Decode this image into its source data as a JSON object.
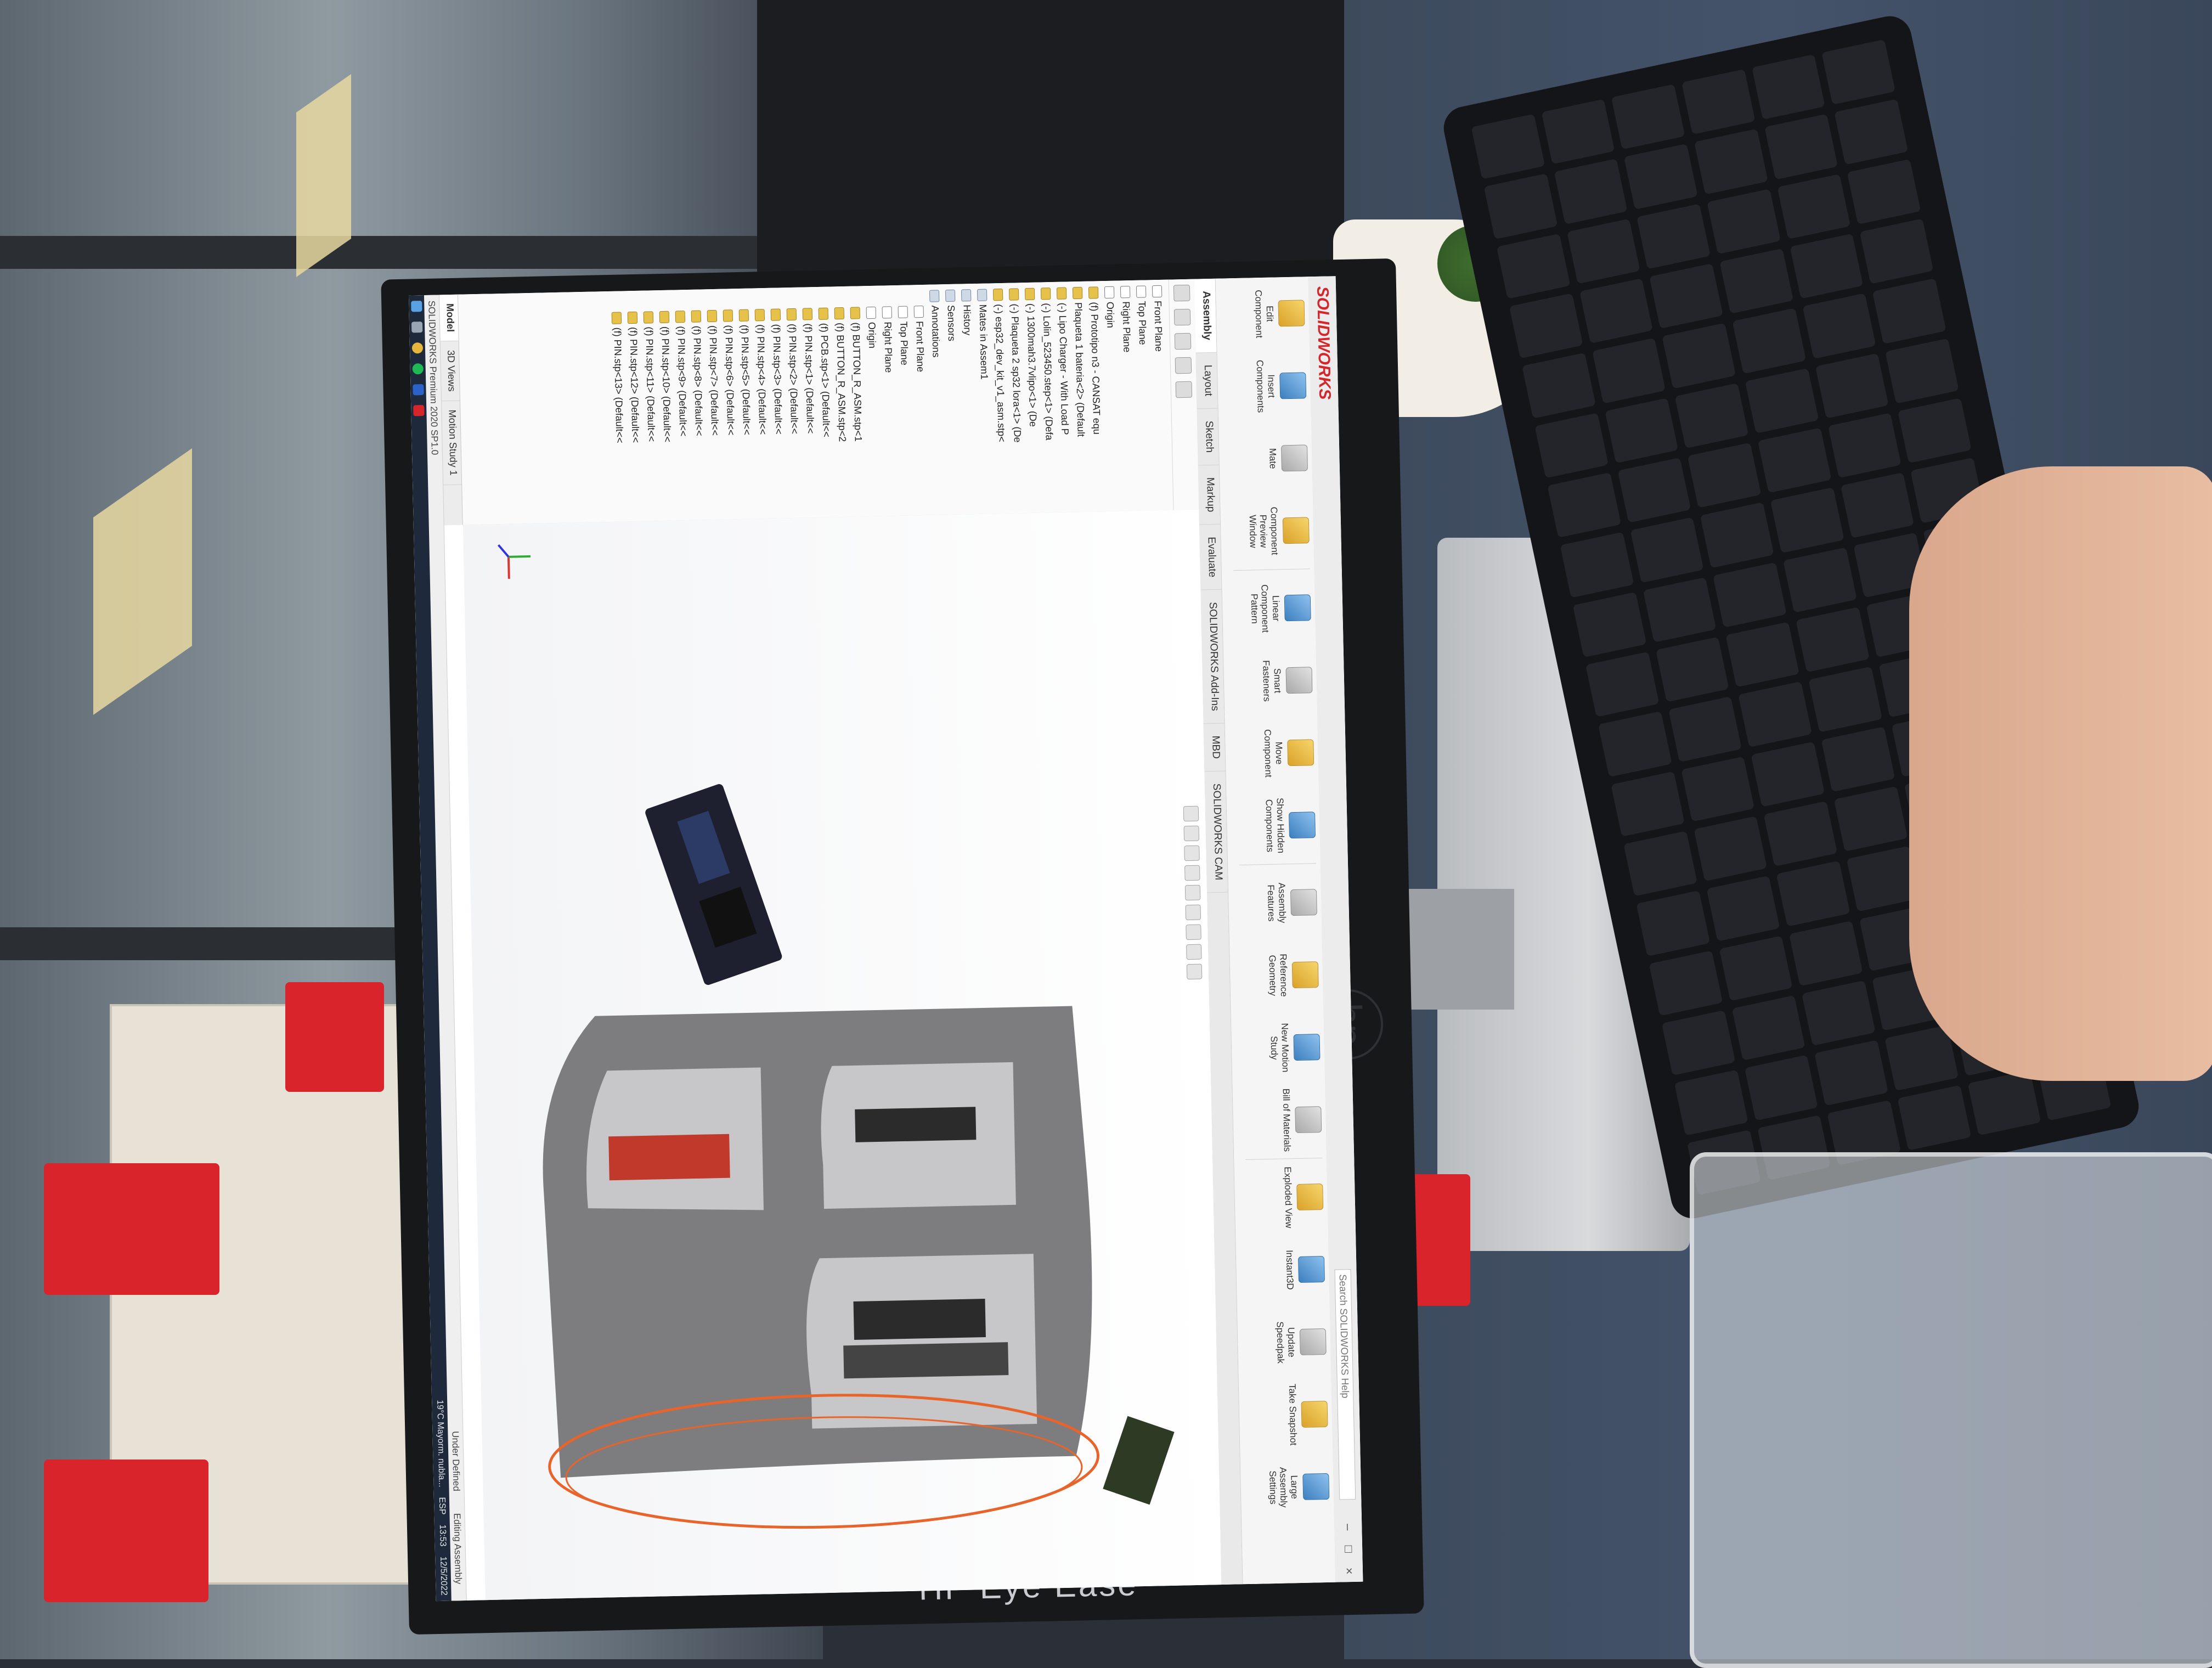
{
  "app": {
    "logo": "SOLIDWORKS",
    "title": "",
    "search_placeholder": "Search SOLIDWORKS Help"
  },
  "command_manager": [
    {
      "label": "Edit Component",
      "icon": "edit-component-icon"
    },
    {
      "label": "Insert Components",
      "icon": "insert-components-icon"
    },
    {
      "label": "Mate",
      "icon": "mate-icon"
    },
    {
      "label": "Component Preview Window",
      "icon": "preview-window-icon"
    },
    {
      "label": "Linear Component Pattern",
      "icon": "pattern-icon"
    },
    {
      "label": "Smart Fasteners",
      "icon": "fasteners-icon"
    },
    {
      "label": "Move Component",
      "icon": "move-component-icon"
    },
    {
      "label": "Show Hidden Components",
      "icon": "show-hidden-icon"
    },
    {
      "label": "Assembly Features",
      "icon": "assembly-features-icon"
    },
    {
      "label": "Reference Geometry",
      "icon": "reference-geometry-icon"
    },
    {
      "label": "New Motion Study",
      "icon": "motion-study-icon"
    },
    {
      "label": "Bill of Materials",
      "icon": "bom-icon"
    },
    {
      "label": "Exploded View",
      "icon": "exploded-view-icon"
    },
    {
      "label": "Instant3D",
      "icon": "instant3d-icon"
    },
    {
      "label": "Update Speedpak",
      "icon": "speedpak-icon"
    },
    {
      "label": "Take Snapshot",
      "icon": "snapshot-icon"
    },
    {
      "label": "Large Assembly Settings",
      "icon": "large-assembly-icon"
    }
  ],
  "command_tabs": [
    "Assembly",
    "Layout",
    "Sketch",
    "Markup",
    "Evaluate",
    "SOLIDWORKS Add-Ins",
    "MBD",
    "SOLIDWORKS CAM"
  ],
  "feature_tree": [
    {
      "label": "Front Plane",
      "type": "plane"
    },
    {
      "label": "Top Plane",
      "type": "plane"
    },
    {
      "label": "Right Plane",
      "type": "plane"
    },
    {
      "label": "Origin",
      "type": "plane"
    },
    {
      "label": "(f) Prototipo n3 - CANSAT equ",
      "type": "part"
    },
    {
      "label": "Plaqueta 1 bateria<2> (Default",
      "type": "part"
    },
    {
      "label": "(-) Lipo Charger - With Load P",
      "type": "part"
    },
    {
      "label": "(-) Lolin_523450.step<1> (Defa",
      "type": "part"
    },
    {
      "label": "(-) 1300mah3.7vlipo<1> (De",
      "type": "part"
    },
    {
      "label": "(-) Plaqueta 2 sp32 lora<1> (De",
      "type": "part"
    },
    {
      "label": "(-) esp32_dev_kit_v1_asm.stp<",
      "type": "part"
    },
    {
      "label": "Mates in Assem1",
      "type": "folder"
    },
    {
      "label": "History",
      "type": "folder"
    },
    {
      "label": "Sensors",
      "type": "folder"
    },
    {
      "label": "Annotations",
      "type": "folder"
    },
    {
      "label": "Front Plane",
      "type": "plane"
    },
    {
      "label": "Top Plane",
      "type": "plane"
    },
    {
      "label": "Right Plane",
      "type": "plane"
    },
    {
      "label": "Origin",
      "type": "plane"
    },
    {
      "label": "(f) BUTTON_R_ASM.stp<1",
      "type": "part"
    },
    {
      "label": "(f) BUTTON_R_ASM.stp<2",
      "type": "part"
    },
    {
      "label": "(f) PCB.stp<1> (Default<<",
      "type": "part"
    },
    {
      "label": "(f) PIN.stp<1> (Default<<",
      "type": "part"
    },
    {
      "label": "(f) PIN.stp<2> (Default<<",
      "type": "part"
    },
    {
      "label": "(f) PIN.stp<3> (Default<<",
      "type": "part"
    },
    {
      "label": "(f) PIN.stp<4> (Default<<",
      "type": "part"
    },
    {
      "label": "(f) PIN.stp<5> (Default<<",
      "type": "part"
    },
    {
      "label": "(f) PIN.stp<6> (Default<<",
      "type": "part"
    },
    {
      "label": "(f) PIN.stp<7> (Default<<",
      "type": "part"
    },
    {
      "label": "(f) PIN.stp<8> (Default<<",
      "type": "part"
    },
    {
      "label": "(f) PIN.stp<9> (Default<<",
      "type": "part"
    },
    {
      "label": "(f) PIN.stp<10> (Default<<",
      "type": "part"
    },
    {
      "label": "(f) PIN.stp<11> (Default<<",
      "type": "part"
    },
    {
      "label": "(f) PIN.stp<12> (Default<<",
      "type": "part"
    },
    {
      "label": "(f) PIN.stp<13> (Default<<",
      "type": "part"
    }
  ],
  "bottom_tabs": [
    "Model",
    "3D Views",
    "Motion Study 1"
  ],
  "status": {
    "left": "SOLIDWORKS Premium 2020 SP1.0",
    "right_1": "Under Defined",
    "right_2": "Editing Assembly"
  },
  "taskbar": {
    "weather": "19°C  Mayorm. nubla...",
    "lang": "ESP",
    "time": "13:53",
    "date": "12/5/2022"
  },
  "monitor": {
    "brand": "HP Eye Ease",
    "logo": "hp"
  },
  "colors": {
    "solidworks_red": "#d4262b",
    "selection_orange": "#e8642a",
    "tube_gray": "#7d7d7f",
    "pcb_dark": "#1e2030"
  }
}
